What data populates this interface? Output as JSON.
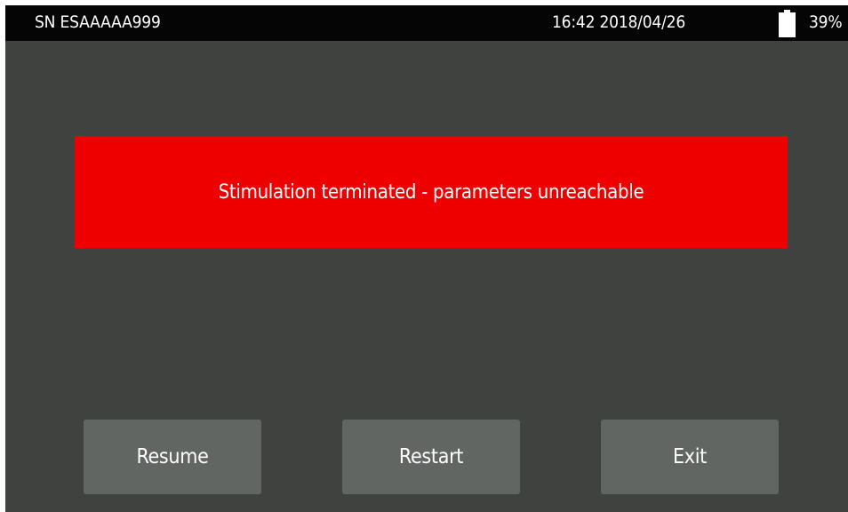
{
  "status_bar": {
    "serial": "SN ESAAAAA999",
    "datetime": "16:42 2018/04/26",
    "battery_icon": "battery-icon",
    "battery_percent": "39%"
  },
  "alert": {
    "message": "Stimulation terminated - parameters unreachable",
    "color": "#ef0000"
  },
  "buttons": {
    "resume_label": "Resume",
    "restart_label": "Restart",
    "exit_label": "Exit"
  },
  "colors": {
    "background": "#3f423f",
    "status_bar": "#050505",
    "button": "#626663",
    "text": "#ffffff"
  }
}
